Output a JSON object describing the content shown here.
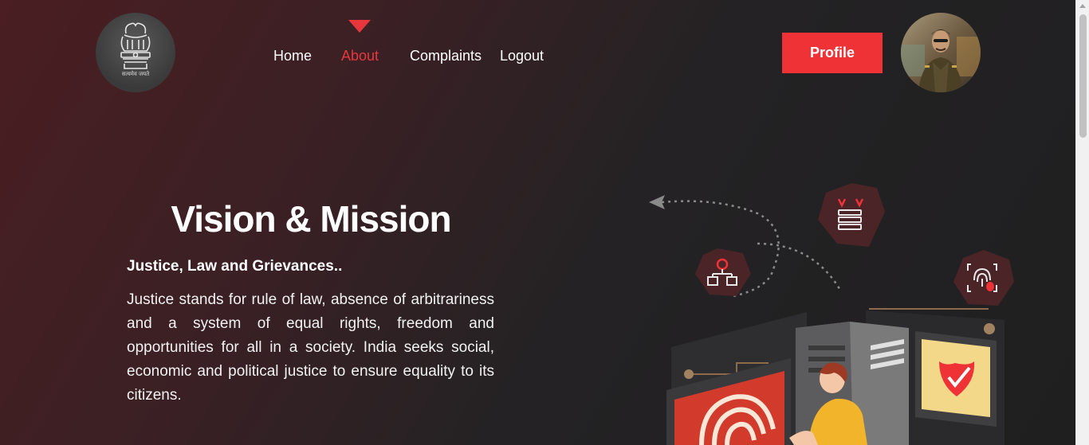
{
  "header": {
    "emblem_motto": "सत्यमेव जयते",
    "nav": [
      {
        "label": "Home",
        "active": false
      },
      {
        "label": "About",
        "active": true
      },
      {
        "label": "Complaints",
        "active": false
      },
      {
        "label": "Logout",
        "active": false
      }
    ],
    "profile_label": "Profile"
  },
  "hero": {
    "title": "Vision & Mission",
    "subtitle": "Justice, Law and Grievances..",
    "body": "Justice stands for rule of law, absence of arbitrariness and a system of equal rights, freedom and opportunities for all in a society. India seeks social, economic and political justice to ensure equality to its citizens."
  },
  "colors": {
    "accent": "#ee3236",
    "active_nav": "#e8373c",
    "background_left": "#4a1e22",
    "background_right": "#1f1f20"
  },
  "icons": [
    "state-emblem-icon",
    "nav-active-marker-icon",
    "user-avatar",
    "malware-network-icon",
    "server-virus-icon",
    "fingerprint-bug-icon",
    "shield-check-icon",
    "fingerprint-icon"
  ]
}
